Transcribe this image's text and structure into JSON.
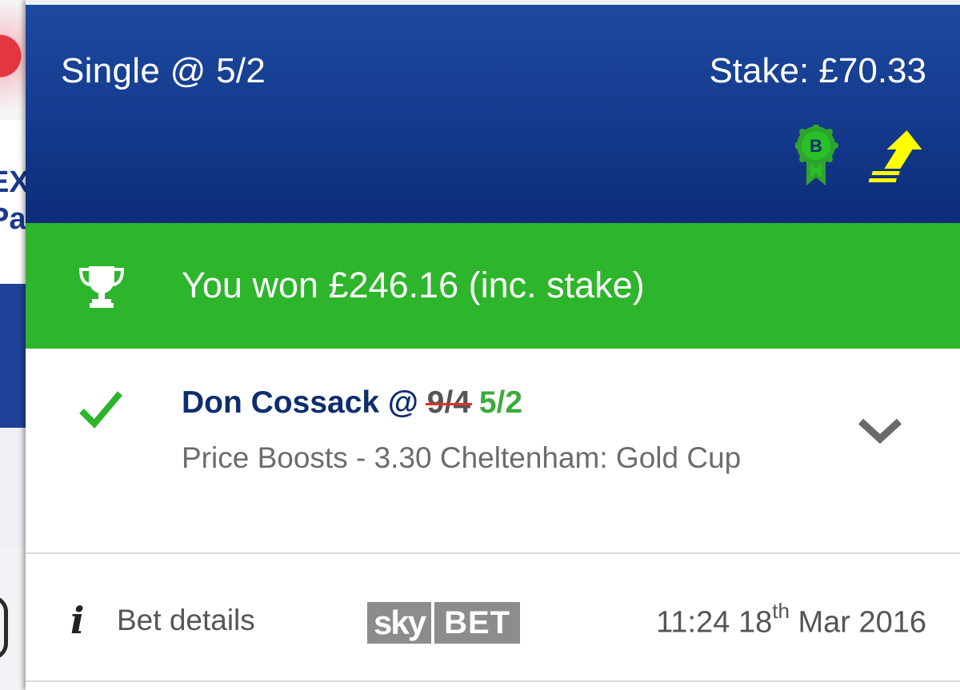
{
  "bet": {
    "title": "Single @ 5/2",
    "stake": "Stake: £70.33"
  },
  "result": {
    "won_text": "You won £246.16 (inc. stake)"
  },
  "selection": {
    "name": "Don Cossack @",
    "old_odds": "9/4",
    "new_odds": "5/2",
    "market": "Price Boosts - 3.30 Cheltenham: Gold Cup"
  },
  "footer": {
    "details_label": "Bet details",
    "logo_sky": "sky",
    "logo_bet": "BET",
    "time": "11:24 18",
    "date_suffix": "th",
    "date_rest": " Mar 2016"
  },
  "icons": {
    "badge": "boost-badge-icon",
    "boost": "price-boost-arrow-icon",
    "trophy": "trophy-icon",
    "check": "check-icon",
    "chevron": "chevron-down-icon",
    "info": "info-icon"
  },
  "colors": {
    "header_blue": "#143a8d",
    "won_green": "#2db52b",
    "odds_green": "#3cab3c",
    "strike_red": "#e3312d",
    "name_navy": "#0e2d6e"
  },
  "background_page": {
    "letters": "EX\nPa"
  }
}
